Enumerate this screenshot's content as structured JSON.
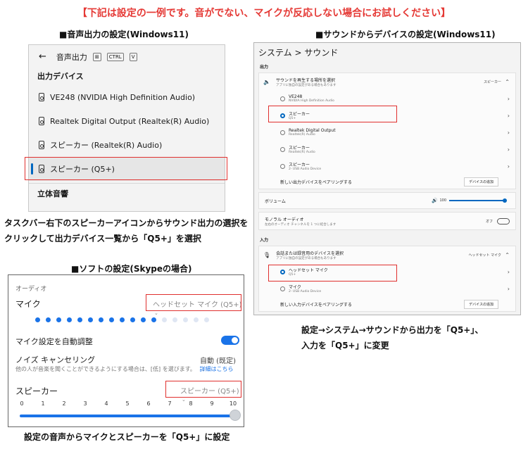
{
  "banner": "【下記は設定の一例です。音がでない、マイクが反応しない場合にお試しください】",
  "section1": {
    "title": "■音声出力の設定(Windows11)",
    "panel": {
      "header": "音声出力",
      "shortcut": [
        "CTRL",
        "V"
      ],
      "devices_label": "出力デバイス",
      "devices": [
        "VE248 (NVIDIA High Definition Audio)",
        "Realtek Digital Output (Realtek(R) Audio)",
        "スピーカー (Realtek(R) Audio)",
        "スピーカー (Q5+)"
      ],
      "selected_index": 3,
      "spatial_label": "立体音響"
    },
    "caption_lines": [
      "タスクバー右下のスピーカーアイコンからサウンド出力の選択を",
      "クリックして出力デバイス一覧から「Q5+」を選択"
    ]
  },
  "section2": {
    "title": "■サウンドからデバイスの設定(Windows11)",
    "panel": {
      "breadcrumb": "システム  >  サウンド",
      "output_label": "出力",
      "output_header": "サウンドを再生する場所を選択",
      "output_header_sub": "アプリに独自の設定がある場合もあります",
      "output_header_value": "スピーカー",
      "output_devices": [
        {
          "name": "VE248",
          "sub": "NVIDIA High Definition Audio",
          "selected": false
        },
        {
          "name": "スピーカー",
          "sub": "Q5+",
          "selected": true
        },
        {
          "name": "Realtek Digital Output",
          "sub": "Realtek(R) Audio",
          "selected": false
        },
        {
          "name": "スピーカー",
          "sub": "Realtek(R) Audio",
          "selected": false
        },
        {
          "name": "スピーカー",
          "sub": "2- USB Audio Device",
          "selected": false
        }
      ],
      "pair_output": "新しい出力デバイスをペアリングする",
      "add_device": "デバイスの追加",
      "volume_label": "ボリューム",
      "volume_value": "100",
      "mono_title": "モノラル オーディオ",
      "mono_sub": "左右のオーディオ チャンネルを 1 つに結合します",
      "mono_state": "オフ",
      "input_label": "入力",
      "input_header": "会話または録音用のデバイスを選択",
      "input_header_sub": "アプリに独自の設定がある場合もあります",
      "input_header_value": "ヘッドセット マイク",
      "input_devices": [
        {
          "name": "ヘッドセット マイク",
          "sub": "Q5+",
          "selected": true
        },
        {
          "name": "マイク",
          "sub": "2- USB Audio Device",
          "selected": false
        }
      ],
      "pair_input": "新しい入力デバイスをペアリングする",
      "add_device_2": "デバイスの追加"
    },
    "caption_lines": [
      "設定→システム→サウンドから出力を「Q5+」、",
      "入力を「Q5+」に変更"
    ]
  },
  "section3": {
    "title": "■ソフトの設定(Skypeの場合)",
    "panel": {
      "audio_label": "オーディオ",
      "mic_label": "マイク",
      "mic_value": "ヘッドセット マイク (Q5+)",
      "mic_level_dots_active": 12,
      "mic_level_dots_total": 17,
      "auto_adjust_label": "マイク設定を自動調整",
      "auto_adjust_on": true,
      "noise_label": "ノイズ キャンセリング",
      "noise_value": "自動 (既定)",
      "noise_desc": "他の人が音楽を聞くことができるようにする場合は、[低] を選びます。",
      "noise_link": "詳細はこちら",
      "speaker_label": "スピーカー",
      "speaker_value": "スピーカー (Q5+)",
      "volume_ticks": [
        "0",
        "1",
        "2",
        "3",
        "4",
        "5",
        "6",
        "7",
        "8",
        "9",
        "10"
      ],
      "volume_level": 10
    },
    "caption": "設定の音声からマイクとスピーカーを「Q5+」に設定"
  },
  "colors": {
    "accent": "#0067c0",
    "skype_accent": "#1a73e8",
    "highlight": "#e0302e",
    "banner": "#e53935"
  }
}
